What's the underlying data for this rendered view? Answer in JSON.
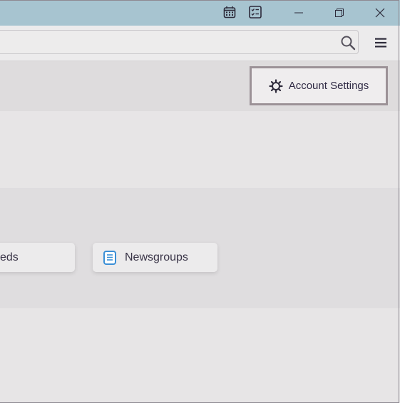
{
  "titlebar": {
    "icons": [
      "calendar-icon",
      "tasks-icon"
    ],
    "window_controls": [
      "minimize-icon",
      "restore-icon",
      "close-icon"
    ]
  },
  "toolbar": {
    "search_placeholder": "",
    "search_icon": "search-icon",
    "menu_icon": "hamburger-menu-icon"
  },
  "header": {
    "account_settings_label": "Account Settings",
    "account_settings_icon": "gear-icon"
  },
  "setup_cards": [
    {
      "label": "eds",
      "icon": "feeds-icon"
    },
    {
      "label": "Newsgroups",
      "icon": "newsgroups-icon"
    }
  ],
  "colors": {
    "titlebar": "#a7c4d0",
    "background": "#e7e5e6",
    "accent_blue": "#3b8fd6",
    "text": "#2f2a44"
  }
}
